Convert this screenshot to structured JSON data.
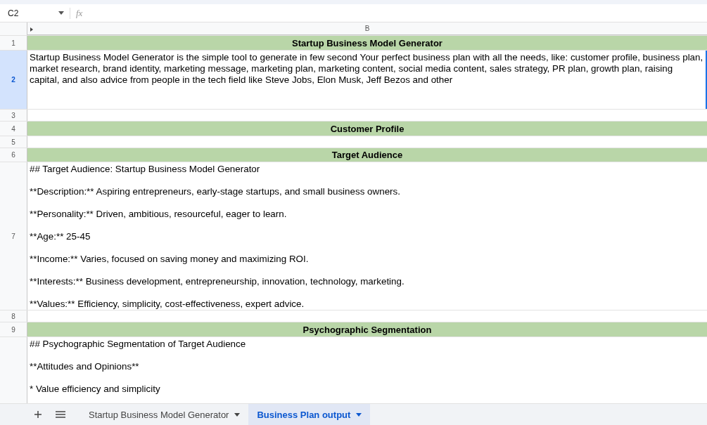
{
  "formula_bar": {
    "cell_ref": "C2",
    "fx": "fx"
  },
  "columns": [
    {
      "label": "B"
    }
  ],
  "rows": [
    {
      "number": "1",
      "kind": "header",
      "selected": false,
      "text": "Startup Business Model Generator"
    },
    {
      "number": "2",
      "kind": "text",
      "selected": true,
      "text": "Startup Business Model Generator is the simple tool to generate in few second Your perfect business plan with all the needs, like: customer profile, business plan, market research, brand identity, marketing message, marketing plan, marketing content, social media content, sales strategy, PR plan, growth plan, raising capital, and also advice from people in the tech field like Steve Jobs, Elon Musk, Jeff Bezos and other"
    },
    {
      "number": "3",
      "kind": "blank",
      "selected": false
    },
    {
      "number": "4",
      "kind": "header",
      "selected": false,
      "text": "Customer Profile"
    },
    {
      "number": "5",
      "kind": "blank",
      "selected": false
    },
    {
      "number": "6",
      "kind": "header",
      "selected": false,
      "text": "Target Audience"
    },
    {
      "number": "7",
      "kind": "text",
      "selected": false,
      "text": "## Target Audience: Startup Business Model Generator\n\n**Description:** Aspiring entrepreneurs, early-stage startups, and small business owners.\n\n**Personality:** Driven, ambitious, resourceful, eager to learn.\n\n**Age:** 25-45\n\n**Income:** Varies, focused on saving money and maximizing ROI.\n\n**Interests:** Business development, entrepreneurship, innovation, technology, marketing.\n\n**Values:** Efficiency, simplicity, cost-effectiveness, expert advice."
    },
    {
      "number": "8",
      "kind": "blank",
      "selected": false
    },
    {
      "number": "9",
      "kind": "header",
      "selected": false,
      "text": "Psychographic Segmentation"
    },
    {
      "kind": "text",
      "selected": false,
      "text": "## Psychographic Segmentation of Target Audience\n\n**Attitudes and Opinions**\n\n* Value efficiency and simplicity"
    }
  ],
  "sheet_tabs": [
    {
      "label": "Startup Business Model Generator",
      "selected": false
    },
    {
      "label": "Business Plan output",
      "selected": true
    }
  ]
}
